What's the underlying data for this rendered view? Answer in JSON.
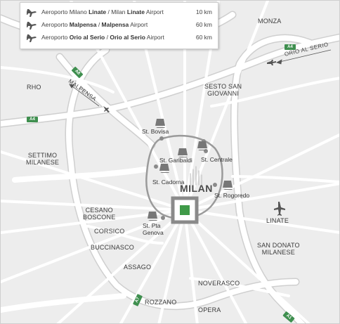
{
  "legend": {
    "rows": [
      {
        "pre": "Aeroporto Milano ",
        "b1": "Linate",
        "mid": " / Milan ",
        "b2": "Linate",
        "post": " Airport",
        "distance": "10 km",
        "icon": "airplane-icon"
      },
      {
        "pre": "Aeroporto ",
        "b1": "Malpensa",
        "mid": " / ",
        "b2": "Malpensa",
        "post": " Airport",
        "distance": "60 km",
        "icon": "airplane-icon"
      },
      {
        "pre": "Aeroporto ",
        "b1": "Orio al Serio",
        "mid": " / ",
        "b2": "Orio al Serio",
        "post": " Airport",
        "distance": "60 km",
        "icon": "airplane-icon"
      }
    ]
  },
  "places": {
    "monza": "MONZA",
    "rho": "RHO",
    "sesto_l1": "SESTO SAN",
    "sesto_l2": "GIOVANNI",
    "settimo_l1": "SETTIMO",
    "settimo_l2": "MILANESE",
    "cesano_l1": "CESANO",
    "cesano_l2": "BOSCONE",
    "corsico": "CORSICO",
    "buccinasco": "BUCCINASCO",
    "assago": "ASSAGO",
    "rozzano": "ROZZANO",
    "opera": "OPERA",
    "noverasco": "NOVERASCO",
    "linate": "LINATE",
    "sandonato_l1": "SAN DONATO",
    "sandonato_l2": "MILANESE"
  },
  "city": "MILAN",
  "stations": {
    "bovisa": "St. Bovisa",
    "garibaldi": "St. Garibaldi",
    "centrale": "St. Centrale",
    "cadorna": "St. Cadorna",
    "rogoredo": "St. Rogoredo",
    "genova_l1": "St. Pta",
    "genova_l2": "Genova"
  },
  "highways": {
    "orio": "ORIO AL SERIO",
    "malpensa": "MALPENSA"
  },
  "shields": {
    "a4_east": "A4",
    "a8": "A8",
    "a4_west": "A4",
    "a7": "A7",
    "a1": "A1"
  },
  "colors": {
    "background": "#ededed",
    "road": "#ffffff",
    "road_casing": "#cfcfcf",
    "ring_rail": "#999999",
    "marker_border": "#8a8a8a",
    "marker_fill": "#3f9a48",
    "shield": "#3f8f4f"
  }
}
